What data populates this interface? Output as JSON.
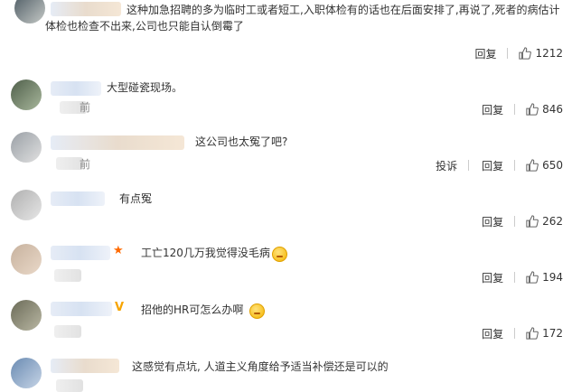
{
  "comments": [
    {
      "text": "这种加急招聘的多为临时工或者短工,入职体检有的话也在后面安排了,再说了,死者的病估计体检也检查不出来,公司也只能自认倒霉了",
      "actions": [
        "回复"
      ],
      "likes": "1212"
    },
    {
      "text": "大型碰瓷现场。",
      "actions": [
        "回复"
      ],
      "likes": "846"
    },
    {
      "text": "这公司也太冤了吧?",
      "actions": [
        "投诉",
        "回复"
      ],
      "likes": "650"
    },
    {
      "text": "有点冤",
      "actions": [
        "回复"
      ],
      "likes": "262"
    },
    {
      "text": "工亡120几万我觉得没毛病",
      "actions": [
        "回复"
      ],
      "likes": "194"
    },
    {
      "text": "招他的HR可怎么办啊",
      "actions": [
        "回复"
      ],
      "likes": "172"
    },
    {
      "text": "这感觉有点坑, 人道主义角度给予适当补偿还是可以的",
      "actions": [],
      "likes": ""
    }
  ],
  "time_fragments": {
    "c2": "前",
    "c3": "前"
  },
  "badges": {
    "star": "★",
    "vip": "V"
  },
  "icons": {
    "like": "thumbs-up-icon"
  },
  "colors": {
    "text": "#333333",
    "star": "#ff6a00",
    "vip": "#f7a400"
  }
}
